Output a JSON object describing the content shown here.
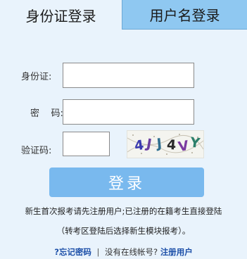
{
  "tabs": {
    "id_login": "身份证登录",
    "username_login": "用户名登录"
  },
  "form": {
    "id_label": "身份证:",
    "password_label": "密    码:",
    "captcha_label": "验证码:",
    "id_value": "",
    "password_value": "",
    "captcha_value": "",
    "captcha_text": "4JJ4VY"
  },
  "login_button": "登录",
  "notice": {
    "line1": "新生首次报考请先注册用户;已注册的在籍考生直接登陆",
    "line2": "（转考区登陆后选择新生模块报考）。"
  },
  "bottom": {
    "forgot_password": "?忘记密码",
    "separator": "|",
    "no_account": "没有在线帐号?",
    "register": "注册用户"
  },
  "colors": {
    "panel_bg": "#e9f3fc",
    "inactive_tab_bg": "#8fc8f1",
    "button_bg": "#79b9ee",
    "link": "#1c4fa8"
  }
}
